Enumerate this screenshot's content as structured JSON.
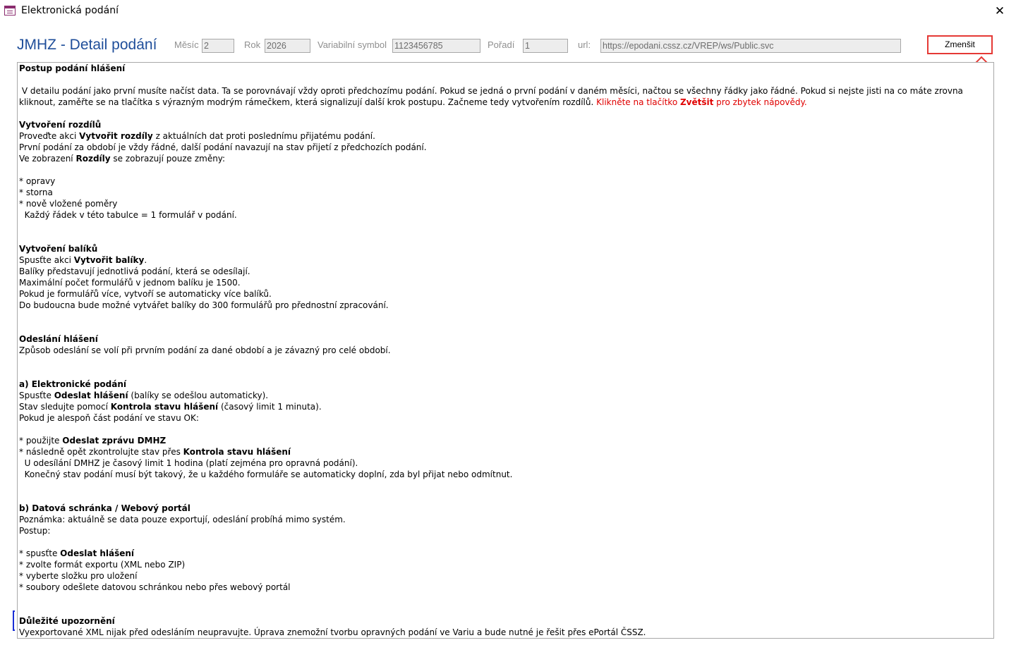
{
  "window": {
    "title": "Elektronická podání",
    "close_symbol": "✕"
  },
  "header": {
    "title": "JMHZ - Detail podání",
    "fields": {
      "mesic": {
        "label": "Měsíc",
        "value": "2"
      },
      "rok": {
        "label": "Rok",
        "value": "2026"
      },
      "vs": {
        "label": "Variabilní symbol",
        "value": "1123456785"
      },
      "poradi": {
        "label": "Pořadí",
        "value": "1"
      },
      "url": {
        "label": "url:",
        "value": "https://epodani.cssz.cz/VREP/ws/Public.svc"
      }
    },
    "zmensit_label": "Zmenšit"
  },
  "help": {
    "heading": "Postup podání hlášení",
    "intro": " V detailu podání jako první musíte načíst data. Ta se porovnávají vždy oproti předchozímu podání. Pokud se jedná o první podání v daném měsíci, načtou se všechny řádky jako řádné. Pokud si nejste jisti na co máte zrovna kliknout, zaměřte se na tlačítka s výrazným modrým rámečkem, která signalizují další krok postupu. Začneme tedy vytvořením rozdílů.",
    "intro_red_pre": " Klikněte na tlačítko ",
    "intro_red_bold": "Zvětšit",
    "intro_red_post": " pro zbytek nápovědy.",
    "s1": {
      "heading": "Vytvoření rozdílů",
      "l1_pre": "Proveďte akci ",
      "l1_b": "Vytvořit rozdíly",
      "l1_post": " z aktuálních dat proti poslednímu přijatému podání.",
      "l2": "První podání za období je vždy řádné, další podání navazují na stav přijetí z předchozích podání.",
      "l3_pre": "Ve zobrazení ",
      "l3_b": "Rozdíly",
      "l3_post": " se zobrazují pouze změny:",
      "b1": "* opravy",
      "b2": "* storna",
      "b3": "* nově vložené poměry",
      "b4": "  Každý řádek v této tabulce = 1 formulář v podání."
    },
    "s2": {
      "heading": "Vytvoření balíků",
      "l1_pre": "Spusťte akci ",
      "l1_b": "Vytvořit balíky",
      "l1_post": ".",
      "l2": "Balíky představují jednotlivá podání, která se odesílají.",
      "l3": "Maximální počet formulářů v jednom balíku je 1500.",
      "l4": "Pokud je formulářů více, vytvoří se automaticky více balíků.",
      "l5": "Do budoucna bude možné vytvářet balíky do 300 formulářů pro přednostní zpracování."
    },
    "s3": {
      "heading": "Odeslání hlášení",
      "l1": "Způsob odeslání se volí při prvním podání za dané období a je závazný pro celé období."
    },
    "s4": {
      "heading": "a) Elektronické podání",
      "l1_pre": "Spusťte ",
      "l1_b": "Odeslat hlášení",
      "l1_post": " (balíky se odešlou automaticky).",
      "l2_pre": "Stav sledujte pomocí ",
      "l2_b": "Kontrola stavu hlášení",
      "l2_post": " (časový limit 1 minuta).",
      "l3": "Pokud je alespoň část podání ve stavu OK:",
      "b1_pre": "* použijte ",
      "b1_b": "Odeslat zprávu DMHZ",
      "b2_pre": "* následně opět zkontrolujte stav přes ",
      "b2_b": "Kontrola stavu hlášení",
      "b3": "  U odesílání DMHZ je časový limit 1 hodina (platí zejména pro opravná podání).",
      "b4": "  Konečný stav podání musí být takový, že u každého formuláře se automaticky doplní, zda byl přijat nebo odmítnut."
    },
    "s5": {
      "heading": "b) Datová schránka / Webový portál",
      "l1": "Poznámka: aktuálně se data pouze exportují, odeslání probíhá mimo systém.",
      "l2": "Postup:",
      "b1_pre": "* spusťte ",
      "b1_b": "Odeslat hlášení",
      "b2": "* zvolte formát exportu (XML nebo ZIP)",
      "b3": "* vyberte složku pro uložení",
      "b4": "* soubory odešlete datovou schránkou nebo přes webový portál"
    },
    "s6": {
      "heading": "Důležité upozornění",
      "l1": "Vyexportované XML nijak před odesláním neupravujte. Úprava znemožní tvorbu opravných podání ve Variu a bude nutné je řešit přes ePortál ČSSZ."
    }
  },
  "colors": {
    "title_blue": "#1f4e9a",
    "highlight_red": "#e53935",
    "focus_blue": "#1a2fd6"
  },
  "icons": {
    "app": "form-icon",
    "arrow": "arrow-up-icon"
  }
}
